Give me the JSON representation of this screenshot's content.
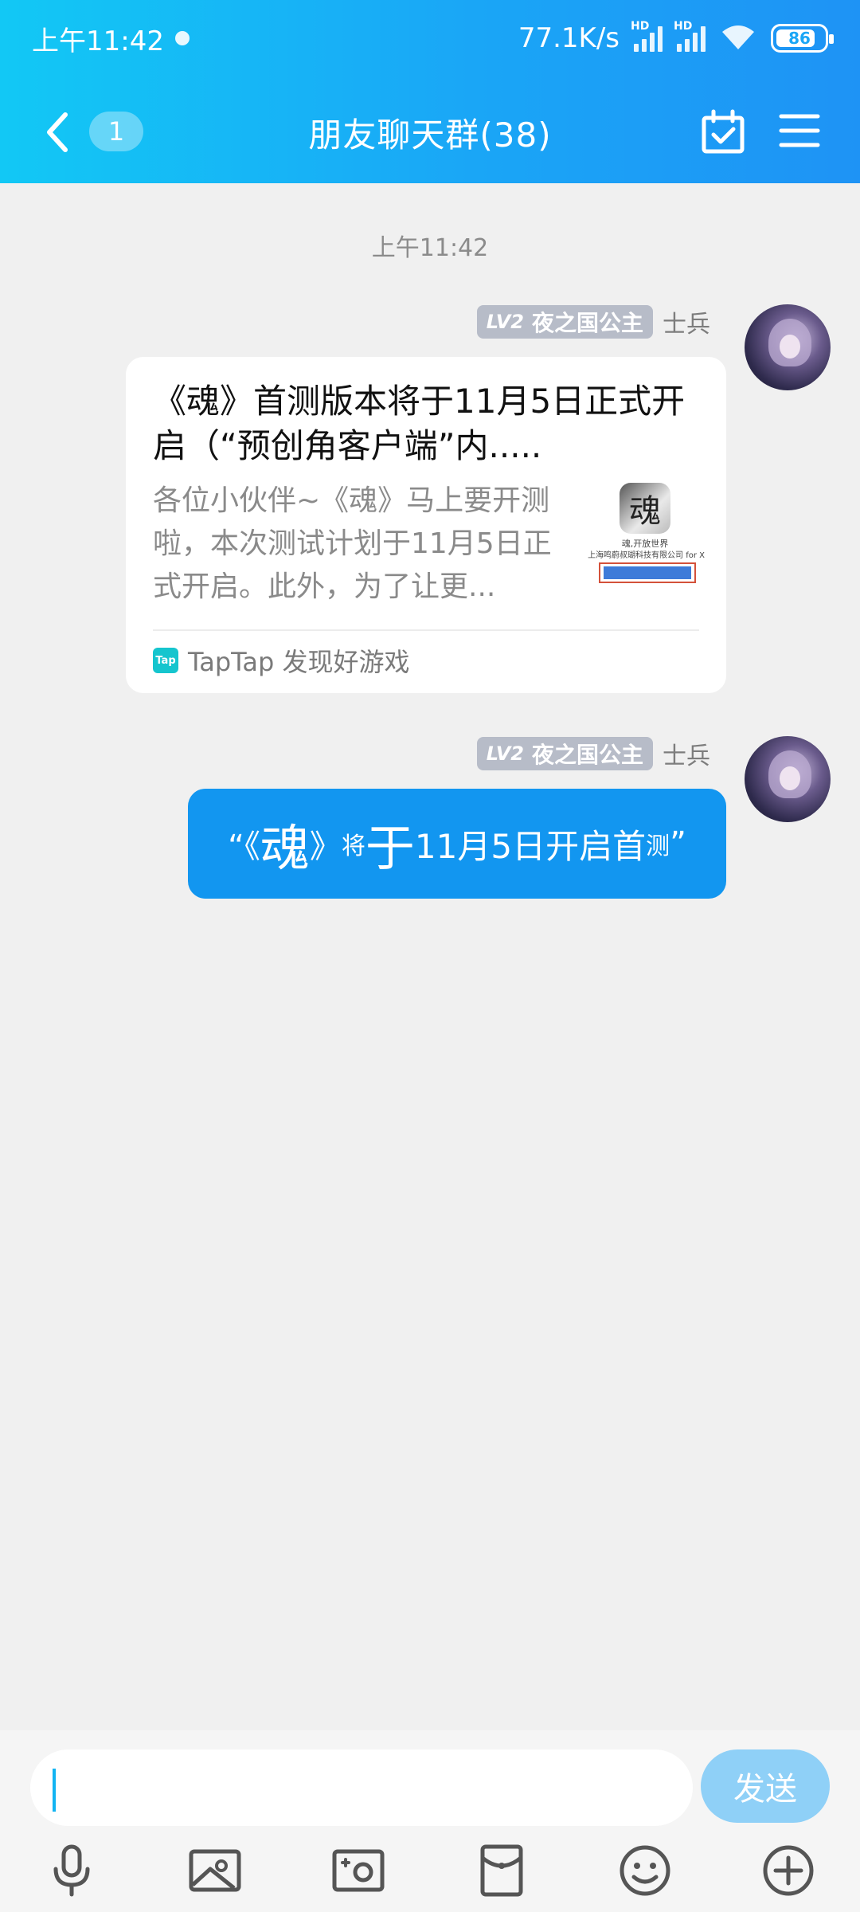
{
  "status_bar": {
    "time": "上午11:42",
    "network_speed": "77.1K/s",
    "signal_label_1": "HD",
    "signal_label_2": "HD",
    "battery": "86"
  },
  "header": {
    "unread_count": "1",
    "title": "朋友聊天群(38)"
  },
  "chat": {
    "timestamp": "上午11:42",
    "messages": [
      {
        "level": "LV2",
        "nickname": "夜之国公主",
        "rank": "士兵",
        "card": {
          "title": "《魂》首测版本将于11月5日正式开启（“预创角客户端”内.....",
          "description": "各位小伙伴~《魂》马上要开测啦，本次测试计划于11月5日正式开启。此外，为了让更...",
          "thumb_logo": "魂",
          "thumb_line1": "魂,开放世界",
          "thumb_line2": "上海鸣蔚叔瑚科技有限公司 for X",
          "source": "TapTap 发现好游戏",
          "source_icon_text": "Tap"
        }
      },
      {
        "level": "LV2",
        "nickname": "夜之国公主",
        "rank": "士兵",
        "text_parts": [
          "“《",
          "魂",
          "》",
          "将",
          "于",
          "11月5日开启首",
          "测",
          "”"
        ]
      }
    ]
  },
  "input": {
    "value": "",
    "send_label": "发送"
  },
  "toolbar": {
    "items": [
      "microphone-icon",
      "image-icon",
      "camera-icon",
      "red-packet-icon",
      "emoji-icon",
      "plus-icon"
    ]
  }
}
